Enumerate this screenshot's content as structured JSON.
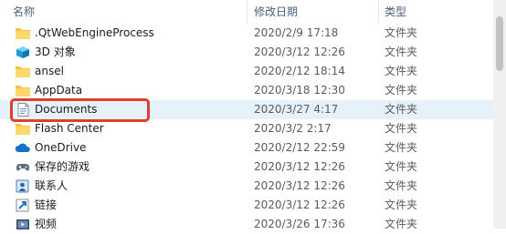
{
  "columns": {
    "name": "名称",
    "date": "修改日期",
    "type": "类型"
  },
  "rows": [
    {
      "name": ".QtWebEngineProcess",
      "date": "2020/2/9 17:18",
      "type": "文件夹",
      "icon": "folder-icon"
    },
    {
      "name": "3D 对象",
      "date": "2020/3/12 12:26",
      "type": "文件夹",
      "icon": "3d-objects-icon"
    },
    {
      "name": "ansel",
      "date": "2020/2/12 18:14",
      "type": "文件夹",
      "icon": "folder-icon"
    },
    {
      "name": "AppData",
      "date": "2020/3/18 12:30",
      "type": "文件夹",
      "icon": "folder-icon"
    },
    {
      "name": "Documents",
      "date": "2020/3/27 4:17",
      "type": "文件夹",
      "icon": "documents-icon"
    },
    {
      "name": "Flash Center",
      "date": "2020/3/2 2:17",
      "type": "文件夹",
      "icon": "folder-icon"
    },
    {
      "name": "OneDrive",
      "date": "2020/2/12 22:59",
      "type": "文件夹",
      "icon": "onedrive-icon"
    },
    {
      "name": "保存的游戏",
      "date": "2020/3/12 12:26",
      "type": "文件夹",
      "icon": "saved-games-icon"
    },
    {
      "name": "联系人",
      "date": "2020/3/12 12:26",
      "type": "文件夹",
      "icon": "contacts-icon"
    },
    {
      "name": "链接",
      "date": "2020/3/12 12:26",
      "type": "文件夹",
      "icon": "links-icon"
    },
    {
      "name": "视频",
      "date": "2020/3/26 17:36",
      "type": "文件夹",
      "icon": "videos-icon"
    }
  ],
  "selected_row": "Documents",
  "colors": {
    "highlight": "#e0402b",
    "selected_bg": "#e5f1fb",
    "folder": "#f5c242"
  }
}
